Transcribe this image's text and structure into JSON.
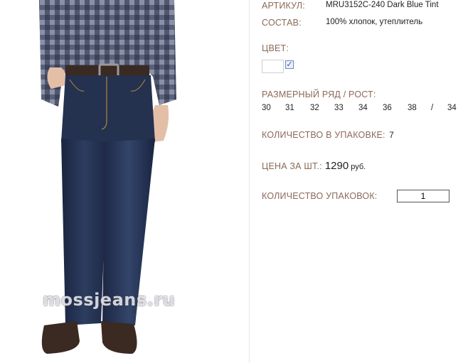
{
  "product": {
    "article_label": "АРТИКУЛ:",
    "article_value": "MRU3152C-240 Dark Blue Tint",
    "composition_label": "СОСТАВ:",
    "composition_value": "100% хлопок, утеплитель",
    "color_label": "ЦВЕТ:",
    "color_checkbox_mark": "✓",
    "size_label": "РАЗМЕРНЫЙ РЯД / РОСТ:",
    "sizes": [
      "30",
      "31",
      "32",
      "33",
      "34",
      "36",
      "38",
      "/",
      "34"
    ],
    "pack_qty_label": "КОЛИЧЕСТВО В УПАКОВКЕ:",
    "pack_qty_value": "7",
    "price_label": "ЦЕНА ЗА ШТ.:",
    "price_value": "1290",
    "price_currency": "руб.",
    "packs_label": "КОЛИЧЕСТВО УПАКОВОК:",
    "packs_value": "1"
  },
  "photo": {
    "watermark": "mossjeans.ru"
  },
  "colors": {
    "label": "#8a6a58",
    "denim": "#1f2b45",
    "shirt": "#4a4f66",
    "shoe": "#3b2a22"
  }
}
